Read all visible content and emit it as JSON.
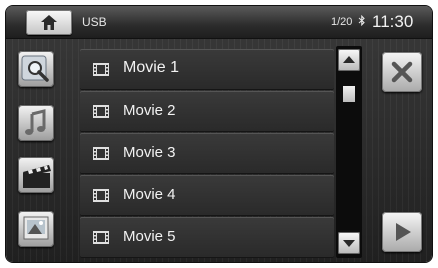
{
  "header": {
    "source": "USB",
    "track_count": "1/20",
    "bluetooth_icon": "bluetooth-icon",
    "clock": "11:30"
  },
  "sidebar": {
    "icons": [
      "search-icon",
      "music-icon",
      "video-clapper-icon",
      "photo-icon"
    ]
  },
  "list": {
    "items": [
      {
        "label": "Movie 1"
      },
      {
        "label": "Movie 2"
      },
      {
        "label": "Movie 3"
      },
      {
        "label": "Movie 4"
      },
      {
        "label": "Movie 5"
      }
    ]
  },
  "controls": {
    "close_icon": "close-icon",
    "play_icon": "play-icon",
    "scroll_up_icon": "triangle-up-icon",
    "scroll_down_icon": "triangle-down-icon"
  }
}
